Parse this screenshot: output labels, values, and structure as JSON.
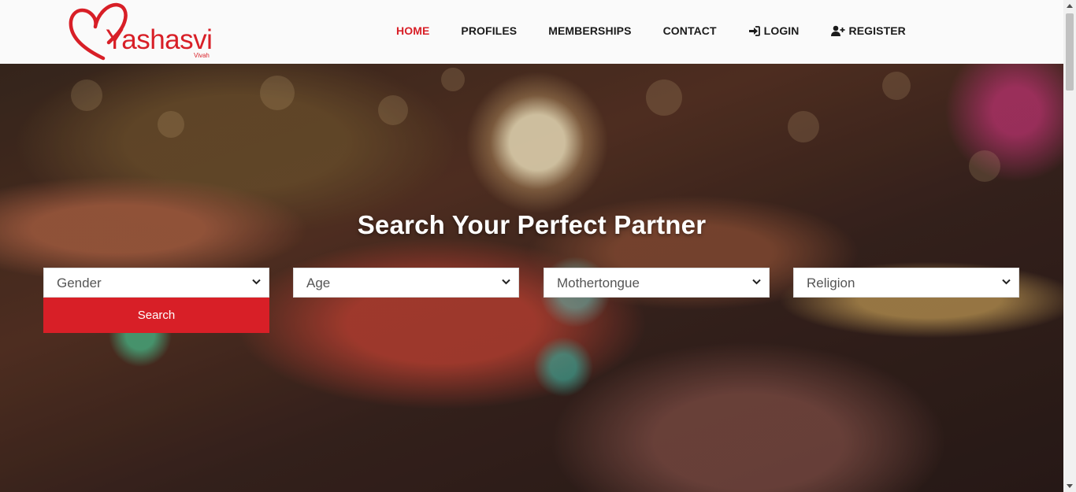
{
  "brand": {
    "name": "Yashasvi",
    "sub": "Vivah",
    "color": "#d81f27"
  },
  "nav": {
    "items": [
      {
        "label": "HOME",
        "active": true
      },
      {
        "label": "PROFILES"
      },
      {
        "label": "MEMBERSHIPS"
      },
      {
        "label": "CONTACT"
      },
      {
        "label": "LOGIN",
        "icon": "sign-in-icon"
      },
      {
        "label": "REGISTER",
        "icon": "user-plus-icon"
      }
    ]
  },
  "hero": {
    "title": "Search Your Perfect Partner",
    "filters": [
      "Gender",
      "Age",
      "Mothertongue",
      "Religion"
    ],
    "search_label": "Search"
  }
}
